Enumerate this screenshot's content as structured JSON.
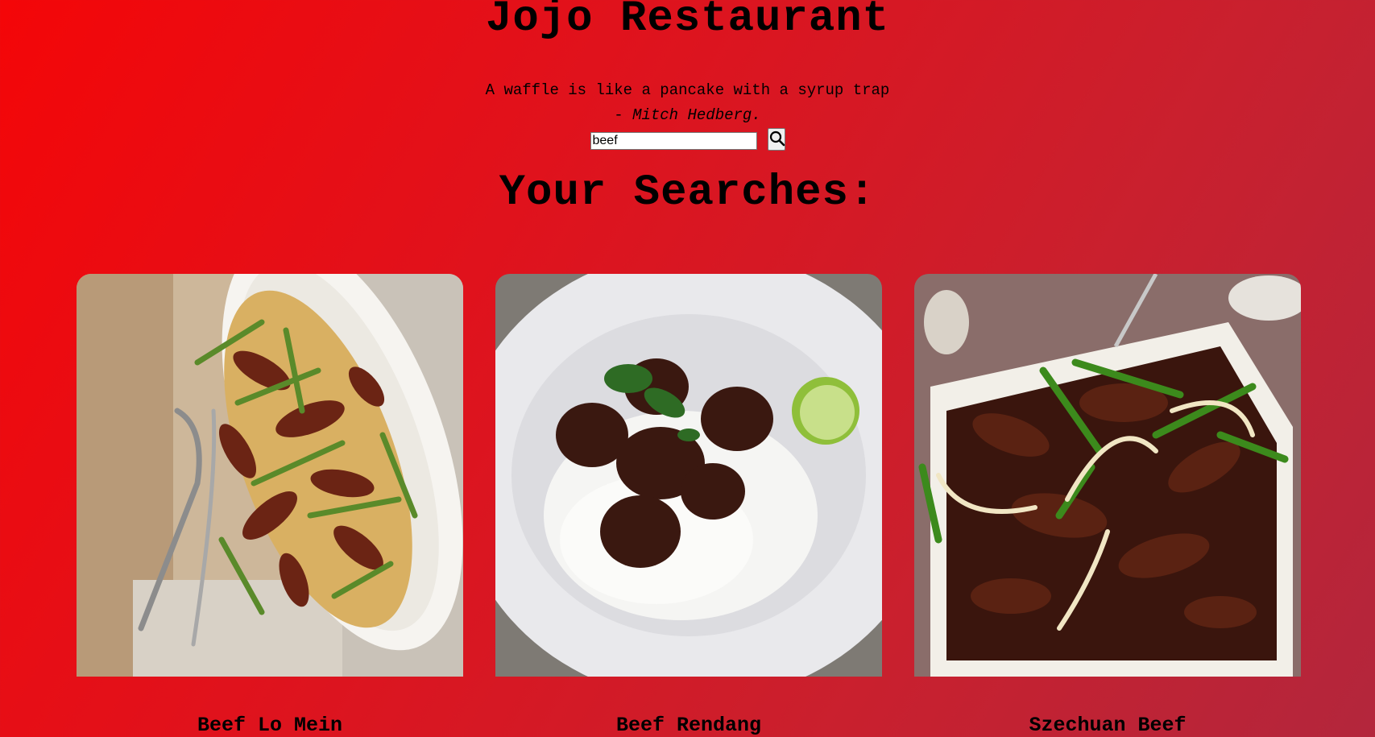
{
  "header": {
    "title": "Jojo Restaurant",
    "quote": "A waffle is like a pancake with a syrup trap",
    "author_prefix": "- ",
    "author": "Mitch Hedberg."
  },
  "search": {
    "value": "beef",
    "button_icon": "search-icon"
  },
  "results": {
    "heading": "Your Searches:",
    "items": [
      {
        "name": "Beef Lo Mein",
        "image": "beef-lo-mein-photo"
      },
      {
        "name": "Beef Rendang",
        "image": "beef-rendang-photo"
      },
      {
        "name": "Szechuan Beef",
        "image": "szechuan-beef-photo"
      }
    ]
  },
  "colors": {
    "background_start": "#f40608",
    "background_end": "#b3263c",
    "text": "#000000"
  }
}
